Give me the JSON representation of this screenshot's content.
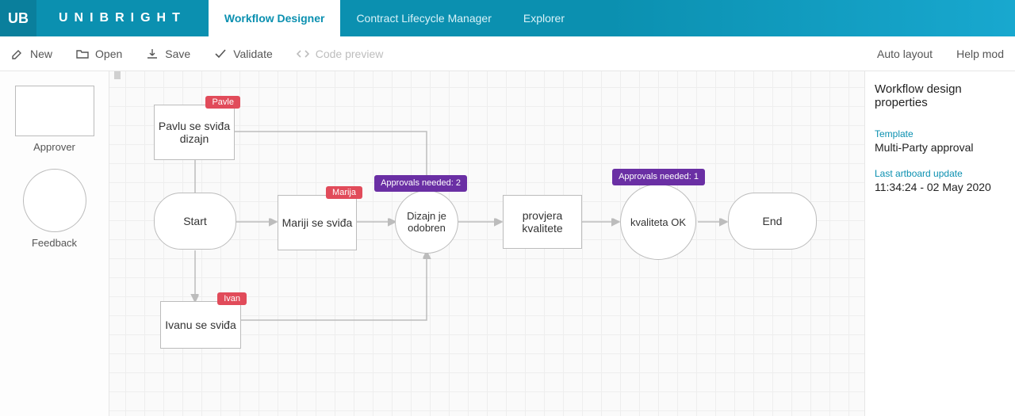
{
  "brand": "UNIBRIGHT",
  "tabs": [
    {
      "label": "Workflow Designer",
      "active": true
    },
    {
      "label": "Contract Lifecycle Manager",
      "active": false
    },
    {
      "label": "Explorer",
      "active": false
    }
  ],
  "toolbar": {
    "new": "New",
    "open": "Open",
    "save": "Save",
    "validate": "Validate",
    "code_preview": "Code preview",
    "auto_layout": "Auto layout",
    "help": "Help mod"
  },
  "palette": {
    "approver": "Approver",
    "feedback": "Feedback"
  },
  "nodes": {
    "start": "Start",
    "pavlu": "Pavlu se sviđa dizajn",
    "mariji": "Mariji se sviđa",
    "ivanu": "Ivanu se sviđa",
    "dizajn": "Dizajn je odobren",
    "provjera": "provjera kvalitete",
    "kvaliteta": "kvaliteta OK",
    "end": "End"
  },
  "tags": {
    "pavle": "Pavle",
    "marija": "Marija",
    "ivan": "Ivan",
    "appr2": "Approvals needed: 2",
    "appr1": "Approvals needed: 1"
  },
  "props": {
    "title": "Workflow design properties",
    "template_label": "Template",
    "template_value": "Multi-Party approval",
    "updated_label": "Last artboard update",
    "updated_value": "11:34:24 - 02 May 2020"
  }
}
